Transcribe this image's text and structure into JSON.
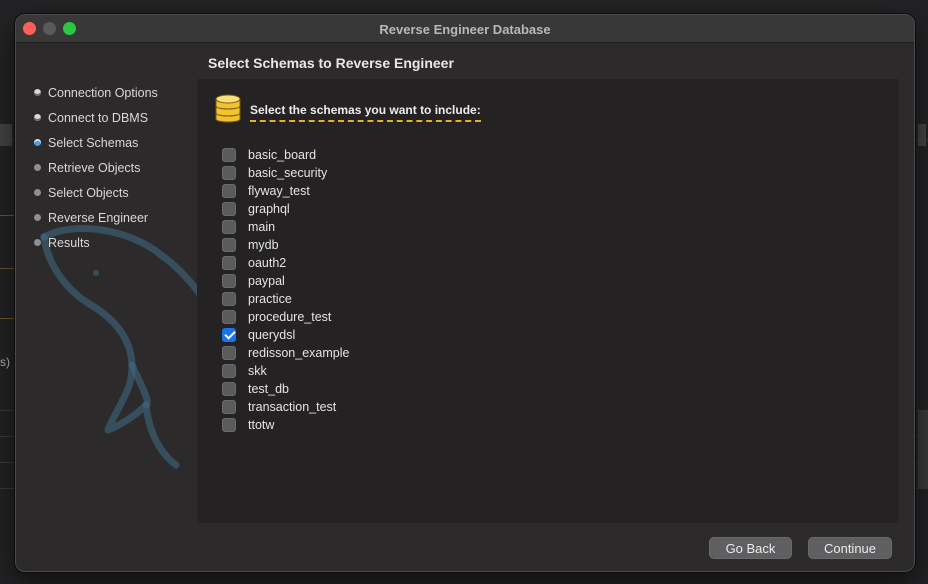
{
  "background": {
    "partial_text": "s)"
  },
  "window": {
    "title": "Reverse Engineer Database"
  },
  "steps": [
    {
      "label": "Connection Options",
      "state": "done"
    },
    {
      "label": "Connect to DBMS",
      "state": "done"
    },
    {
      "label": "Select Schemas",
      "state": "current"
    },
    {
      "label": "Retrieve Objects",
      "state": "pending"
    },
    {
      "label": "Select Objects",
      "state": "pending"
    },
    {
      "label": "Reverse Engineer",
      "state": "pending"
    },
    {
      "label": "Results",
      "state": "pending"
    }
  ],
  "page": {
    "heading": "Select Schemas to Reverse Engineer",
    "prompt": "Select the schemas you want to include:",
    "prompt_underline_color": "#e6b020",
    "icon": "database-icon"
  },
  "schemas": [
    {
      "name": "basic_board",
      "checked": false
    },
    {
      "name": "basic_security",
      "checked": false
    },
    {
      "name": "flyway_test",
      "checked": false
    },
    {
      "name": "graphql",
      "checked": false
    },
    {
      "name": "main",
      "checked": false
    },
    {
      "name": "mydb",
      "checked": false
    },
    {
      "name": "oauth2",
      "checked": false
    },
    {
      "name": "paypal",
      "checked": false
    },
    {
      "name": "practice",
      "checked": false
    },
    {
      "name": "procedure_test",
      "checked": false
    },
    {
      "name": "querydsl",
      "checked": true
    },
    {
      "name": "redisson_example",
      "checked": false
    },
    {
      "name": "skk",
      "checked": false
    },
    {
      "name": "test_db",
      "checked": false
    },
    {
      "name": "transaction_test",
      "checked": false
    },
    {
      "name": "ttotw",
      "checked": false
    }
  ],
  "buttons": {
    "back": "Go Back",
    "continue": "Continue"
  },
  "colors": {
    "accent": "#1b73e8",
    "close": "#fe5f57",
    "maximize": "#28c840"
  }
}
